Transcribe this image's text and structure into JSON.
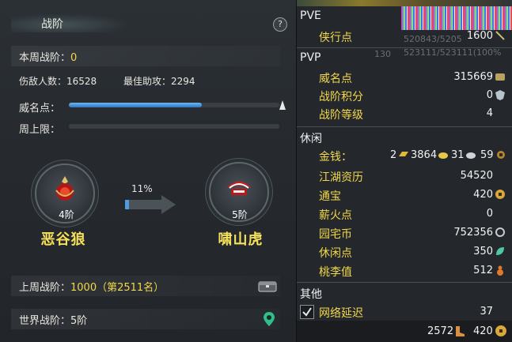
{
  "left_panel": {
    "title": "战阶",
    "help": "?",
    "weekly_rank_label": "本周战阶：",
    "weekly_rank_value": "0",
    "injured_label": "伤敌人数：16528",
    "best_assist_label": "最佳助攻：2294",
    "prestige_label": "威名点：",
    "prestige_fill": 0.63,
    "weekly_cap_label": "周上限：",
    "weekly_cap_fill": 0,
    "current_rank": {
      "level": "4阶",
      "name": "恶谷狼"
    },
    "next_rank": {
      "level": "5阶",
      "name": "啸山虎"
    },
    "progress_text": "11%",
    "progress_fill": 0.11,
    "last_week_label": "上周战阶：",
    "last_week_value": "1000（第2511名）",
    "world_rank_label": "世界战阶：5阶"
  },
  "right_panel": {
    "sections": {
      "pve": "PVE",
      "pvp": "PVP",
      "leisure": "休闲",
      "other": "其他"
    },
    "rows": {
      "xiaxing": {
        "label": "侠行点",
        "value": "1600"
      },
      "weiming": {
        "label": "威名点",
        "value": "315669"
      },
      "zhanjie_score": {
        "label": "战阶积分",
        "value": "0"
      },
      "zhanjie_level": {
        "label": "战阶等级",
        "value": "4"
      },
      "money": {
        "label": "金钱：",
        "v1": "2",
        "v2": "3864",
        "v3": "31",
        "v4": "59"
      },
      "jianghu": {
        "label": "江湖资历",
        "value": "54520"
      },
      "tongbao": {
        "label": "通宝",
        "value": "420"
      },
      "xinhuo": {
        "label": "薪火点",
        "value": "0"
      },
      "yuanzhai": {
        "label": "园宅币",
        "value": "752356"
      },
      "xiuxian": {
        "label": "休闲点",
        "value": "350"
      },
      "taoli": {
        "label": "桃李值",
        "value": "512"
      },
      "latency": {
        "label": "网络延迟",
        "value": "37"
      }
    },
    "bottom": {
      "v1": "2572",
      "v2": "420"
    },
    "ghost_text": {
      "a": "520843/5205",
      "b": "130",
      "c": "523111/523111(100%"
    }
  }
}
